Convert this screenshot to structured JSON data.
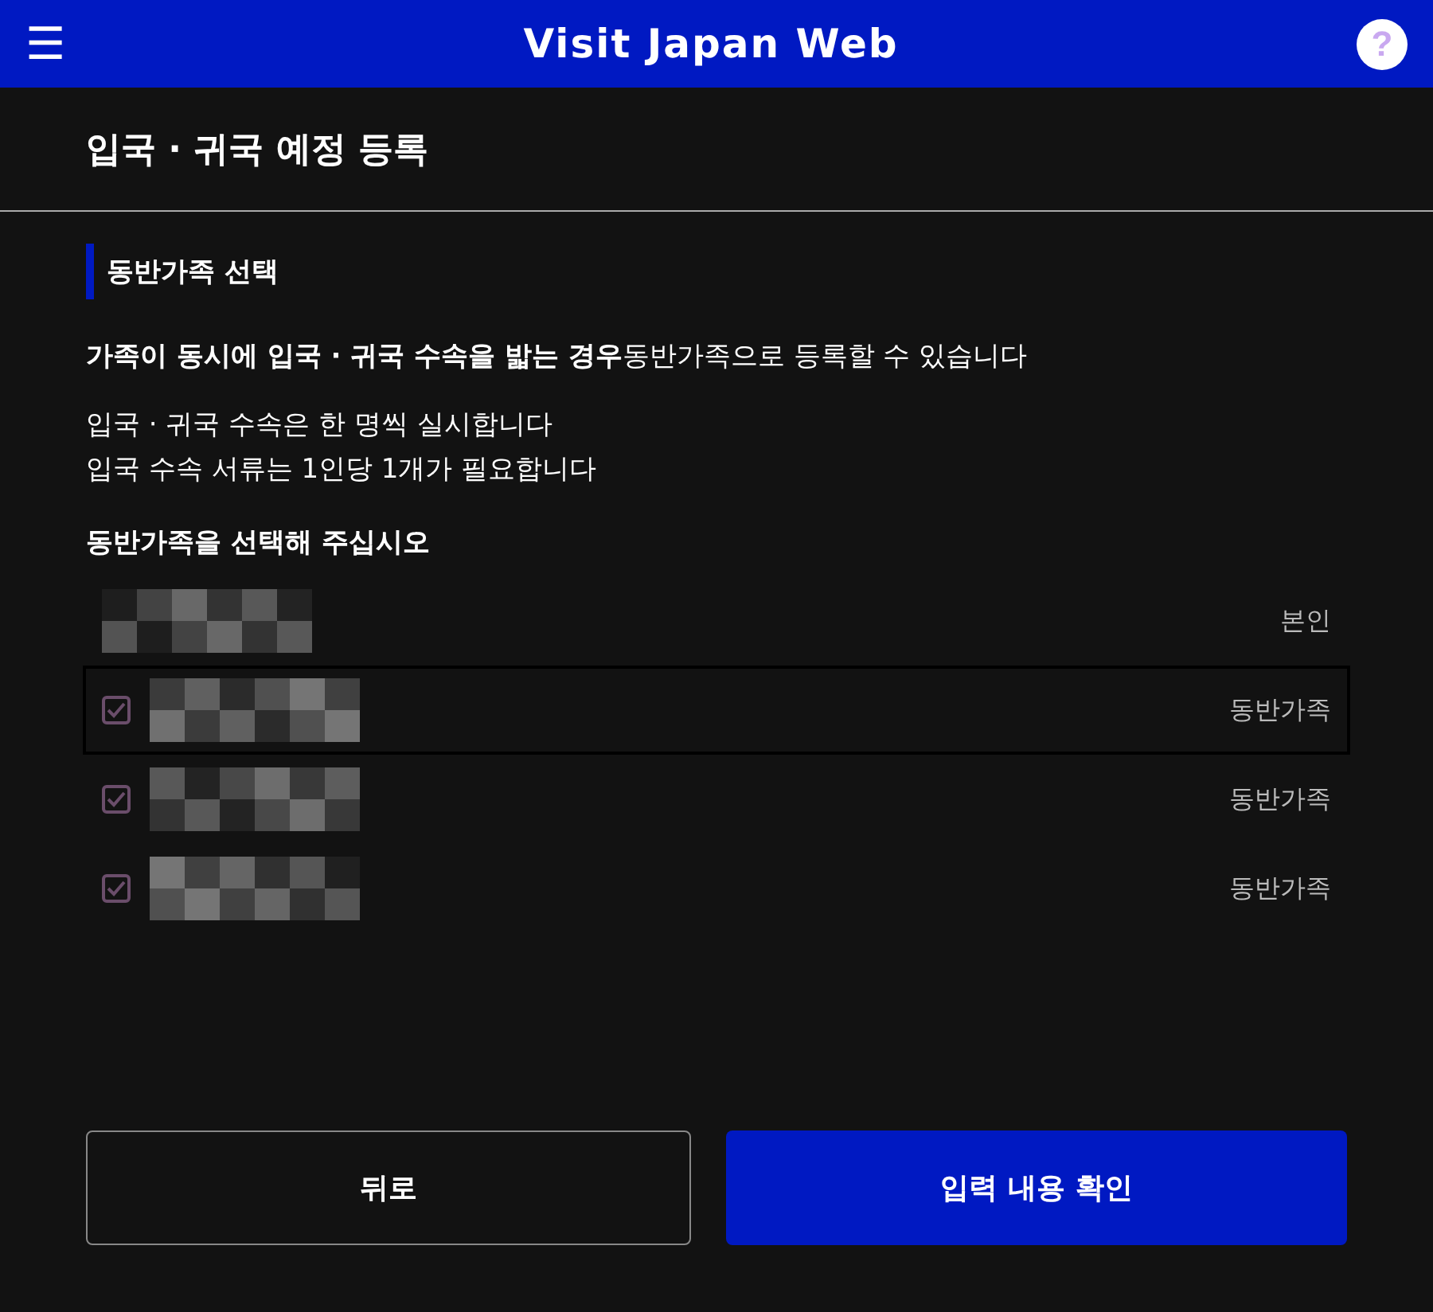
{
  "header": {
    "menu_icon": "☰",
    "title": "Visit Japan Web",
    "help_icon": "?"
  },
  "page_title": "입국 · 귀국 예정 등록",
  "section_title": "동반가족 선택",
  "intro": "**가족이 동시에 입국 · 귀국 수속을 밟는 경우**동반가족으로 등록할 수 있습니다",
  "notes": [
    "입국 · 귀국 수속은 한 명씩 실시합니다",
    "입국 수속 서류는 1인당 1개가 필요합니다"
  ],
  "prompt": "동반가족을 선택해 주십시오",
  "members": [
    {
      "kind": "self",
      "role": "본인",
      "highlighted": false
    },
    {
      "kind": "companion",
      "role": "동반가족",
      "checked": true,
      "highlighted": true
    },
    {
      "kind": "companion",
      "role": "동반가족",
      "checked": true,
      "highlighted": false
    },
    {
      "kind": "companion",
      "role": "동반가족",
      "checked": true,
      "highlighted": false
    }
  ],
  "buttons": [
    {
      "label": "뒤로",
      "kind": "secondary"
    },
    {
      "label": "입력 내용 확인",
      "kind": "primary"
    }
  ]
}
